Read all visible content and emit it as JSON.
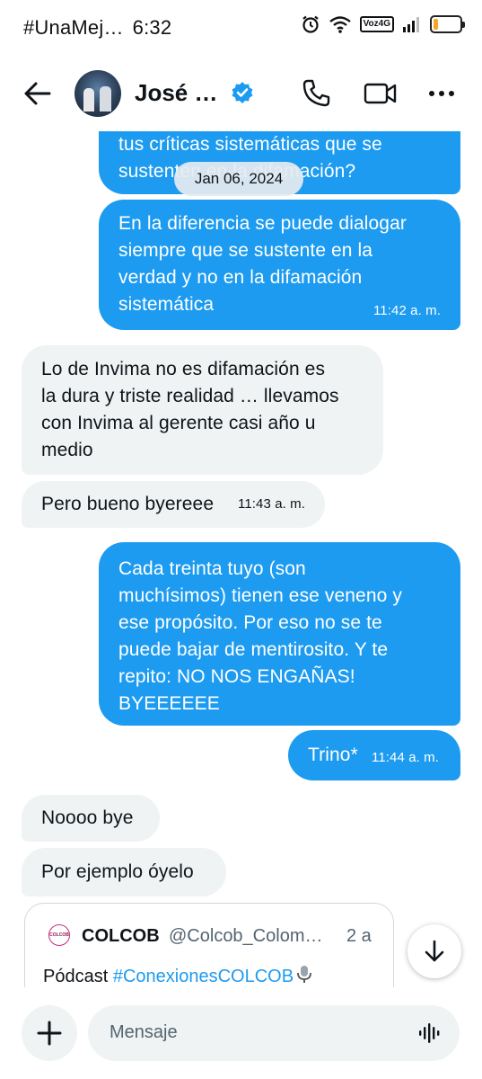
{
  "status_bar": {
    "notification": "#UnaMej…",
    "time": "6:32",
    "network": "Voz4G",
    "battery_level": 0.18,
    "battery_color": "#f5a623"
  },
  "header": {
    "contact_name": "José …",
    "icons": [
      "arrow-left-icon",
      "verified-badge-icon",
      "phone-icon",
      "video-camera-icon",
      "more-horizontal-icon"
    ]
  },
  "date_separator": "Jan 06, 2024",
  "messages": [
    {
      "side": "sent",
      "text": "tus críticas sistemáticas que se\nsustenten en la difamación?",
      "time": ""
    },
    {
      "side": "sent",
      "text": "En la diferencia se puede dialogar\nsiempre que se sustente en la\nverdad y no en la difamación\nsistemática",
      "time": "11:42 a. m."
    },
    {
      "side": "received",
      "text": "Lo de Invima no es difamación es\nla dura y triste realidad … llevamos\ncon Invima al gerente casi año u\nmedio",
      "time": ""
    },
    {
      "side": "received",
      "text": "Pero bueno byereee",
      "time": "11:43 a. m."
    },
    {
      "side": "sent",
      "text": "Cada treinta tuyo (son\nmuchísimos) tienen ese veneno y\nese propósito. Por eso no se te\npuede bajar de mentirosito. Y te\nrepito: NO NOS ENGAÑAS!\nBYEEEEEE",
      "time": ""
    },
    {
      "side": "sent",
      "text": "Trino*",
      "time": "11:44 a. m."
    },
    {
      "side": "received",
      "text": "Noooo bye",
      "time": ""
    },
    {
      "side": "received",
      "text": "Por ejemplo óyelo",
      "time": ""
    }
  ],
  "quoted_post": {
    "avatar_text": "COLCOB",
    "name": "COLCOB",
    "handle": "@Colcob_Colom…",
    "age": "2 a",
    "text_prefix": "Pódcast ",
    "hashtag": "#ConexionesCOLCOB",
    "trailing_icon": "microphone-emoji-icon"
  },
  "composer": {
    "placeholder": "Mensaje"
  },
  "colors": {
    "sent_bubble": "#1d9bf0",
    "received_bubble": "#eff3f4",
    "link": "#1d9bf0"
  }
}
